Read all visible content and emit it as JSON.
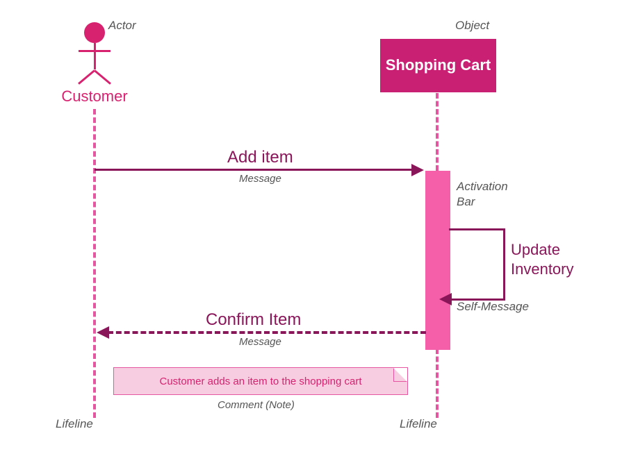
{
  "annotations": {
    "actor": "Actor",
    "object": "Object",
    "activation_bar_l1": "Activation",
    "activation_bar_l2": "Bar",
    "self_message": "Self-Message",
    "lifeline_left": "Lifeline",
    "lifeline_right": "Lifeline",
    "message_add": "Message",
    "message_confirm": "Message",
    "comment": "Comment (Note)"
  },
  "actor": {
    "name": "Customer"
  },
  "object": {
    "label": "Shopping Cart"
  },
  "messages": {
    "add_item": "Add item",
    "confirm_item": "Confirm Item",
    "update_inventory_l1": "Update",
    "update_inventory_l2": "Inventory"
  },
  "note": {
    "text": "Customer adds an item to the shopping cart"
  },
  "colors": {
    "actor_pink": "#d7226f",
    "object_fill": "#c92073",
    "lifeline_pink": "#e556a0",
    "activation_pink": "#f55ea8",
    "arrow_dark": "#8a165a",
    "note_fill": "#f7cde2",
    "annot_grey": "#555555"
  }
}
